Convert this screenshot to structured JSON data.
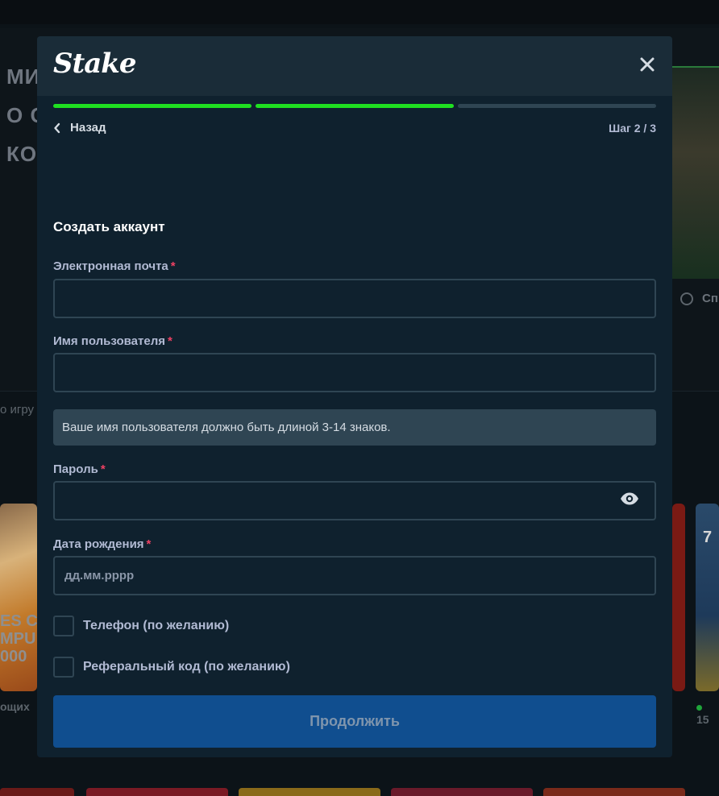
{
  "modal": {
    "logo_text": "Stake",
    "close_symbol": "✕",
    "progress": {
      "current_step": 2,
      "total_steps": 3
    },
    "back_label": "Назад",
    "step_label": "Шаг 2 / 3",
    "title": "Создать аккаунт",
    "fields": {
      "email": {
        "label": "Электронная почта",
        "required_mark": "*",
        "value": "",
        "placeholder": ""
      },
      "username": {
        "label": "Имя пользователя",
        "required_mark": "*",
        "value": "",
        "placeholder": ""
      },
      "username_hint": "Ваше имя пользователя должно быть длиной 3-14 знаков.",
      "password": {
        "label": "Пароль",
        "required_mark": "*",
        "value": "",
        "placeholder": ""
      },
      "birthdate": {
        "label": "Дата рождения",
        "required_mark": "*",
        "value": "",
        "placeholder": "дд.мм.рррр"
      }
    },
    "checkboxes": [
      {
        "label": "Телефон (по желанию)",
        "checked": false
      },
      {
        "label": "Реферальный код (по желанию)",
        "checked": false
      }
    ],
    "submit_label": "Продолжить"
  },
  "background": {
    "hero_fragments": [
      "МИ",
      "О С",
      "КО"
    ],
    "sidebar_label": "Сп",
    "games_label": "о игру",
    "card_left_text": "ES C\nMPU\n000",
    "card_right_number": "7",
    "below_left": "ощих",
    "below_right": "15"
  },
  "colors": {
    "modal_bg": "#0f212e",
    "header_bg": "#1a2c38",
    "progress_done": "#1fe021",
    "progress_pending": "#2f4553",
    "required": "#ed4163",
    "button_bg": "#104e8f"
  },
  "icons": [
    "close-icon",
    "chevron-left-icon",
    "eye-icon"
  ]
}
